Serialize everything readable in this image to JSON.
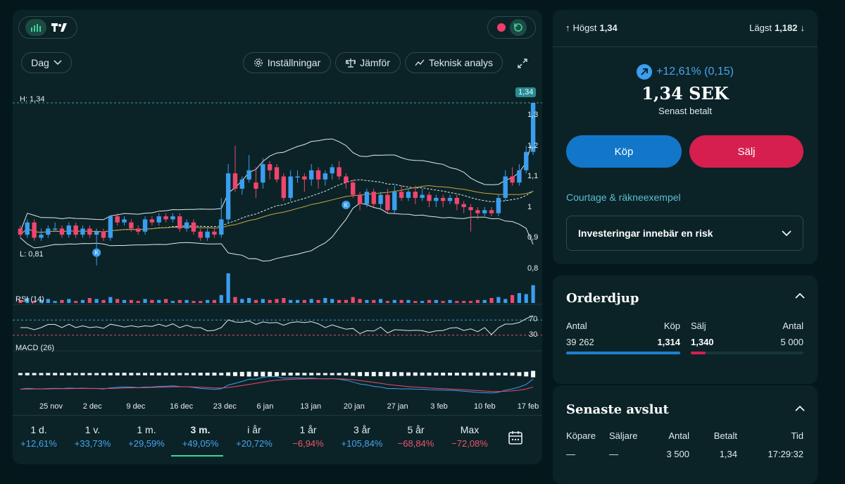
{
  "toolbar": {
    "period_select": "Dag",
    "settings_label": "Inställningar",
    "compare_label": "Jämför",
    "technical_label": "Teknisk analys"
  },
  "chart_data": {
    "type": "candlestick",
    "high_label": "H: 1,34",
    "low_label": "L: 0,81",
    "last_price_tag": "1,34",
    "y_ticks": [
      "1,3",
      "1,2",
      "1,1",
      "1",
      "0,9",
      "0,8"
    ],
    "y_tick_values": [
      1.3,
      1.2,
      1.1,
      1.0,
      0.9,
      0.8
    ],
    "ylim": [
      0.8,
      1.34
    ],
    "x_ticks": [
      "25 nov",
      "2 dec",
      "9 dec",
      "16 dec",
      "23 dec",
      "6 jan",
      "13 jan",
      "20 jan",
      "27 jan",
      "3 feb",
      "10 feb",
      "17 feb"
    ],
    "markers": [
      "K",
      "K"
    ],
    "candles": [
      {
        "o": 0.93,
        "c": 0.91,
        "h": 0.94,
        "l": 0.9
      },
      {
        "o": 0.91,
        "c": 0.95,
        "h": 0.96,
        "l": 0.9
      },
      {
        "o": 0.95,
        "c": 0.9,
        "h": 0.96,
        "l": 0.89
      },
      {
        "o": 0.9,
        "c": 0.91,
        "h": 0.93,
        "l": 0.89
      },
      {
        "o": 0.91,
        "c": 0.93,
        "h": 0.94,
        "l": 0.9
      },
      {
        "o": 0.93,
        "c": 0.93,
        "h": 0.95,
        "l": 0.92
      },
      {
        "o": 0.93,
        "c": 0.91,
        "h": 0.94,
        "l": 0.9
      },
      {
        "o": 0.91,
        "c": 0.94,
        "h": 0.95,
        "l": 0.9
      },
      {
        "o": 0.94,
        "c": 0.91,
        "h": 0.95,
        "l": 0.9
      },
      {
        "o": 0.91,
        "c": 0.93,
        "h": 0.94,
        "l": 0.9
      },
      {
        "o": 0.93,
        "c": 0.91,
        "h": 0.94,
        "l": 0.9
      },
      {
        "o": 0.91,
        "c": 0.92,
        "h": 0.93,
        "l": 0.81
      },
      {
        "o": 0.92,
        "c": 0.9,
        "h": 0.93,
        "l": 0.89
      },
      {
        "o": 0.9,
        "c": 0.97,
        "h": 0.97,
        "l": 0.89
      },
      {
        "o": 0.97,
        "c": 0.95,
        "h": 0.98,
        "l": 0.94
      },
      {
        "o": 0.95,
        "c": 0.96,
        "h": 0.97,
        "l": 0.94
      },
      {
        "o": 0.95,
        "c": 0.93,
        "h": 0.96,
        "l": 0.92
      },
      {
        "o": 0.93,
        "c": 0.92,
        "h": 0.94,
        "l": 0.91
      },
      {
        "o": 0.92,
        "c": 0.96,
        "h": 0.97,
        "l": 0.91
      },
      {
        "o": 0.96,
        "c": 0.95,
        "h": 0.97,
        "l": 0.94
      },
      {
        "o": 0.95,
        "c": 0.97,
        "h": 0.98,
        "l": 0.94
      },
      {
        "o": 0.97,
        "c": 0.96,
        "h": 0.98,
        "l": 0.95
      },
      {
        "o": 0.96,
        "c": 0.97,
        "h": 0.98,
        "l": 0.95
      },
      {
        "o": 0.97,
        "c": 0.93,
        "h": 0.98,
        "l": 0.92
      },
      {
        "o": 0.93,
        "c": 0.95,
        "h": 0.96,
        "l": 0.92
      },
      {
        "o": 0.95,
        "c": 0.92,
        "h": 0.96,
        "l": 0.91
      },
      {
        "o": 0.92,
        "c": 0.9,
        "h": 0.93,
        "l": 0.89
      },
      {
        "o": 0.9,
        "c": 0.92,
        "h": 0.93,
        "l": 0.89
      },
      {
        "o": 0.92,
        "c": 0.91,
        "h": 0.93,
        "l": 0.9
      },
      {
        "o": 0.91,
        "c": 0.96,
        "h": 1.03,
        "l": 0.9
      },
      {
        "o": 0.96,
        "c": 1.11,
        "h": 1.14,
        "l": 0.95
      },
      {
        "o": 1.11,
        "c": 1.06,
        "h": 1.2,
        "l": 1.05
      },
      {
        "o": 1.06,
        "c": 1.09,
        "h": 1.1,
        "l": 1.04
      },
      {
        "o": 1.09,
        "c": 1.12,
        "h": 1.17,
        "l": 1.08
      },
      {
        "o": 1.08,
        "c": 1.06,
        "h": 1.13,
        "l": 1.03
      },
      {
        "o": 1.08,
        "c": 1.14,
        "h": 1.16,
        "l": 1.06
      },
      {
        "o": 1.14,
        "c": 1.12,
        "h": 1.15,
        "l": 1.09
      },
      {
        "o": 1.13,
        "c": 1.09,
        "h": 1.14,
        "l": 1.08
      },
      {
        "o": 1.1,
        "c": 1.03,
        "h": 1.11,
        "l": 1.02
      },
      {
        "o": 1.03,
        "c": 1.1,
        "h": 1.12,
        "l": 1.02
      },
      {
        "o": 1.1,
        "c": 1.1,
        "h": 1.12,
        "l": 1.08
      },
      {
        "o": 1.1,
        "c": 1.09,
        "h": 1.11,
        "l": 1.05
      },
      {
        "o": 1.09,
        "c": 1.12,
        "h": 1.14,
        "l": 1.07
      },
      {
        "o": 1.12,
        "c": 1.09,
        "h": 1.13,
        "l": 1.06
      },
      {
        "o": 1.09,
        "c": 1.11,
        "h": 1.12,
        "l": 1.07
      },
      {
        "o": 1.11,
        "c": 1.13,
        "h": 1.14,
        "l": 1.09
      },
      {
        "o": 1.13,
        "c": 1.1,
        "h": 1.15,
        "l": 1.09
      },
      {
        "o": 1.1,
        "c": 1.08,
        "h": 1.11,
        "l": 1.06
      },
      {
        "o": 1.08,
        "c": 1.04,
        "h": 1.09,
        "l": 1.03
      },
      {
        "o": 1.04,
        "c": 1.01,
        "h": 1.05,
        "l": 0.99
      },
      {
        "o": 1.01,
        "c": 1.05,
        "h": 1.06,
        "l": 1.0
      },
      {
        "o": 1.05,
        "c": 1.01,
        "h": 1.06,
        "l": 1.0
      },
      {
        "o": 1.01,
        "c": 1.04,
        "h": 1.05,
        "l": 0.99
      },
      {
        "o": 1.04,
        "c": 0.99,
        "h": 1.06,
        "l": 0.98
      },
      {
        "o": 0.99,
        "c": 1.05,
        "h": 1.07,
        "l": 0.98
      },
      {
        "o": 1.05,
        "c": 1.03,
        "h": 1.07,
        "l": 1.02
      },
      {
        "o": 1.03,
        "c": 1.05,
        "h": 1.06,
        "l": 1.02
      },
      {
        "o": 1.05,
        "c": 1.03,
        "h": 1.07,
        "l": 1.01
      },
      {
        "o": 1.03,
        "c": 1.04,
        "h": 1.06,
        "l": 1.02
      },
      {
        "o": 1.04,
        "c": 1.02,
        "h": 1.05,
        "l": 1.0
      },
      {
        "o": 1.02,
        "c": 1.03,
        "h": 1.04,
        "l": 1.0
      },
      {
        "o": 1.03,
        "c": 1.02,
        "h": 1.04,
        "l": 1.0
      },
      {
        "o": 1.02,
        "c": 1.03,
        "h": 1.04,
        "l": 1.01
      },
      {
        "o": 1.03,
        "c": 1.01,
        "h": 1.04,
        "l": 0.99
      },
      {
        "o": 1.01,
        "c": 1.0,
        "h": 1.02,
        "l": 0.98
      },
      {
        "o": 1.0,
        "c": 0.99,
        "h": 1.01,
        "l": 0.92
      },
      {
        "o": 0.99,
        "c": 0.98,
        "h": 1.0,
        "l": 0.96
      },
      {
        "o": 0.98,
        "c": 0.99,
        "h": 1.0,
        "l": 0.97
      },
      {
        "o": 0.99,
        "c": 0.98,
        "h": 1.0,
        "l": 0.97
      },
      {
        "o": 0.98,
        "c": 1.03,
        "h": 1.04,
        "l": 0.97
      },
      {
        "o": 1.03,
        "c": 1.1,
        "h": 1.12,
        "l": 1.02
      },
      {
        "o": 1.1,
        "c": 1.08,
        "h": 1.13,
        "l": 1.07
      },
      {
        "o": 1.08,
        "c": 1.12,
        "h": 1.14,
        "l": 1.07
      },
      {
        "o": 1.12,
        "c": 1.18,
        "h": 1.2,
        "l": 1.11
      },
      {
        "o": 1.18,
        "c": 1.34,
        "h": 1.34,
        "l": 1.17
      }
    ],
    "volume": [
      3,
      5,
      2,
      3,
      4,
      2,
      3,
      4,
      2,
      3,
      5,
      4,
      3,
      6,
      4,
      3,
      3,
      2,
      4,
      3,
      3,
      4,
      2,
      3,
      3,
      2,
      2,
      3,
      3,
      8,
      30,
      6,
      4,
      5,
      3,
      4,
      3,
      4,
      5,
      3,
      3,
      3,
      4,
      3,
      5,
      4,
      3,
      3,
      6,
      4,
      3,
      3,
      4,
      2,
      3,
      3,
      3,
      2,
      2,
      3,
      3,
      2,
      3,
      2,
      2,
      2,
      3,
      3,
      5,
      6,
      4,
      8,
      10,
      9,
      18
    ],
    "rsi_label": "RSI (14)",
    "rsi_levels": [
      70,
      30
    ],
    "macd_label": "MACD (26)"
  },
  "periods": [
    {
      "label": "1 d.",
      "value": "+12,61%",
      "dir": "pos"
    },
    {
      "label": "1 v.",
      "value": "+33,73%",
      "dir": "pos"
    },
    {
      "label": "1 m.",
      "value": "+29,59%",
      "dir": "pos"
    },
    {
      "label": "3 m.",
      "value": "+49,05%",
      "dir": "pos"
    },
    {
      "label": "i år",
      "value": "+20,72%",
      "dir": "pos"
    },
    {
      "label": "1 år",
      "value": "−6,94%",
      "dir": "neg"
    },
    {
      "label": "3 år",
      "value": "+105,84%",
      "dir": "pos"
    },
    {
      "label": "5 år",
      "value": "−68,84%",
      "dir": "neg"
    },
    {
      "label": "Max",
      "value": "−72,08%",
      "dir": "neg"
    }
  ],
  "quote": {
    "high_label": "Högst",
    "high_value": "1,34",
    "low_label": "Lägst",
    "low_value": "1,182",
    "change": "+12,61% (0,15)",
    "price": "1,34 SEK",
    "price_caption": "Senast betalt",
    "buy_label": "Köp",
    "sell_label": "Sälj",
    "courtage_link": "Courtage & räkneexempel",
    "risk_label": "Investeringar innebär en risk"
  },
  "orderbook": {
    "title": "Orderdjup",
    "col_qty_left": "Antal",
    "col_buy": "Köp",
    "col_sell": "Sälj",
    "col_qty_right": "Antal",
    "buy_qty": "39 262",
    "buy_price": "1,314",
    "sell_price": "1,340",
    "sell_qty": "5 000",
    "buy_fill": 1.0,
    "sell_fill": 0.13
  },
  "trades": {
    "title": "Senaste avslut",
    "headers": [
      "Köpare",
      "Säljare",
      "Antal",
      "Betalt",
      "Tid"
    ],
    "rows": [
      [
        "—",
        "—",
        "3 500",
        "1,34",
        "17:29:32"
      ]
    ]
  },
  "colors": {
    "up": "#3b9eef",
    "down": "#f0466e",
    "buy": "#1277c9",
    "sell": "#d61f4f",
    "accent": "#5bbdd0"
  }
}
